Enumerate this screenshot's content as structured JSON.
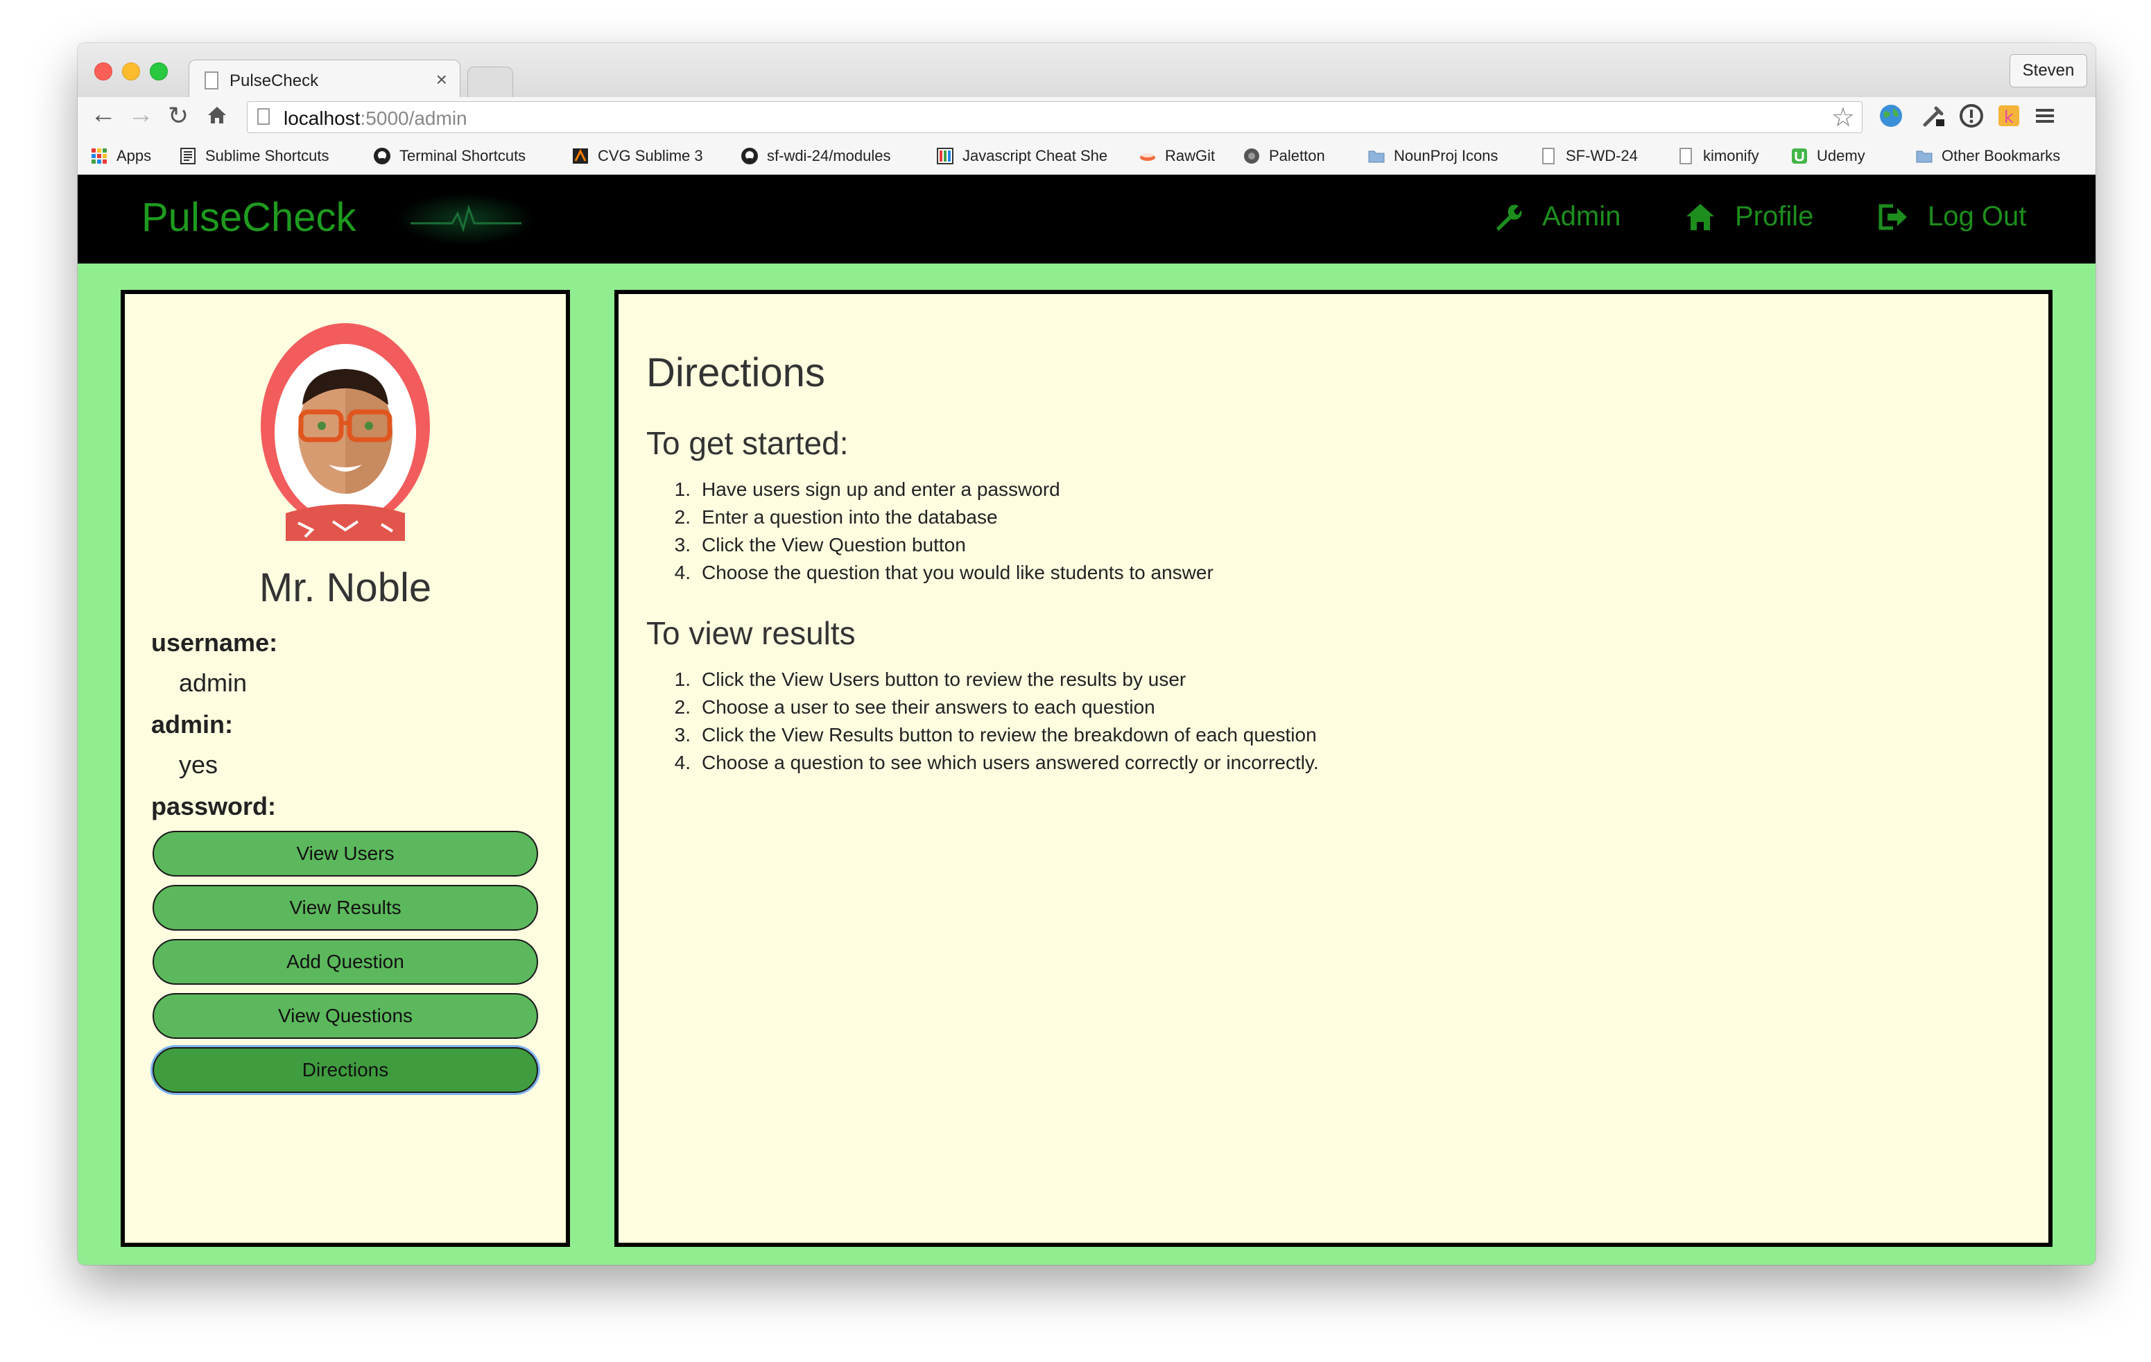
{
  "browser": {
    "tab_title": "PulseCheck",
    "tab_close": "×",
    "profile_name": "Steven",
    "url_host": "localhost",
    "url_path": ":5000/admin",
    "bookmarks": [
      {
        "label": "Apps",
        "icon": "apps-grid-icon"
      },
      {
        "label": "Sublime Shortcuts",
        "icon": "document-icon"
      },
      {
        "label": "Terminal Shortcuts",
        "icon": "github-icon"
      },
      {
        "label": "CVG Sublime 3",
        "icon": "cvg-icon"
      },
      {
        "label": "sf-wdi-24/modules",
        "icon": "github-icon"
      },
      {
        "label": "Javascript Cheat She",
        "icon": "cheatsheet-icon"
      },
      {
        "label": "RawGit",
        "icon": "rawgit-icon"
      },
      {
        "label": "Paletton",
        "icon": "paletton-icon"
      },
      {
        "label": "NounProj Icons",
        "icon": "folder-icon"
      },
      {
        "label": "SF-WD-24",
        "icon": "page-icon"
      },
      {
        "label": "kimonify",
        "icon": "page-icon"
      },
      {
        "label": "Udemy",
        "icon": "udemy-icon"
      },
      {
        "label": "Other Bookmarks",
        "icon": "folder-icon"
      }
    ]
  },
  "nav": {
    "brand": "PulseCheck",
    "links": [
      {
        "label": "Admin",
        "icon": "wrench-icon"
      },
      {
        "label": "Profile",
        "icon": "home-icon"
      },
      {
        "label": "Log Out",
        "icon": "logout-icon"
      }
    ],
    "color": "#1e9b1e"
  },
  "sidebar": {
    "name": "Mr. Noble",
    "fields": [
      {
        "label": "username:",
        "value": "admin"
      },
      {
        "label": "admin:",
        "value": "yes"
      },
      {
        "label": "password:",
        "value": ""
      }
    ],
    "buttons": [
      {
        "label": "View Users",
        "active": false
      },
      {
        "label": "View Results",
        "active": false
      },
      {
        "label": "Add Question",
        "active": false
      },
      {
        "label": "View Questions",
        "active": false
      },
      {
        "label": "Directions",
        "active": true
      }
    ],
    "button_color": "#5cb85c"
  },
  "main": {
    "title": "Directions",
    "sections": [
      {
        "heading": "To get started:",
        "steps": [
          "Have users sign up and enter a password",
          "Enter a question into the database",
          "Click the View Question button",
          "Choose the question that you would like students to answer"
        ]
      },
      {
        "heading": "To view results",
        "steps": [
          "Click the View Users button to review the results by user",
          "Choose a user to see their answers to each question",
          "Click the View Results button to review the breakdown of each question",
          "Choose a question to see which users answered correctly or incorrectly."
        ]
      }
    ]
  },
  "colors": {
    "page_background": "#90ee90",
    "panel_background": "#fefde0",
    "navbar": "#000000"
  }
}
